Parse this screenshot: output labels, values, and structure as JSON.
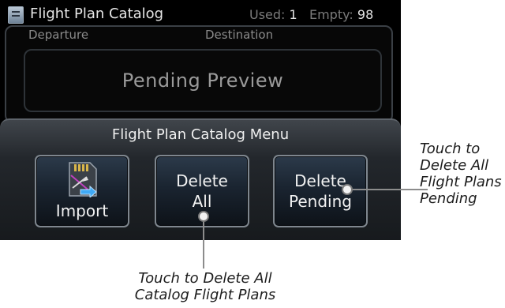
{
  "header": {
    "title": "Flight Plan Catalog",
    "used_label": "Used:",
    "used_value": "1",
    "empty_label": "Empty:",
    "empty_value": "98",
    "icon": "catalog-icon"
  },
  "preview": {
    "departure_label": "Departure",
    "destination_label": "Destination",
    "pending_text": "Pending Preview"
  },
  "menu": {
    "title": "Flight Plan Catalog Menu",
    "buttons": [
      {
        "lines": [
          "Import"
        ],
        "icon": "import-sd-card-icon"
      },
      {
        "lines": [
          "Delete",
          "All"
        ]
      },
      {
        "lines": [
          "Delete",
          "Pending"
        ]
      }
    ]
  },
  "annotations": {
    "right_caption": [
      "Touch to",
      "Delete All",
      "Flight Plans",
      "Pending"
    ],
    "bottom_caption": [
      "Touch to Delete All",
      "Catalog Flight Plans"
    ]
  },
  "colors": {
    "screen_background": "#000000",
    "button_border": "#7e868e",
    "text_primary": "#f0f0f0",
    "text_muted": "#8a8a8a"
  }
}
